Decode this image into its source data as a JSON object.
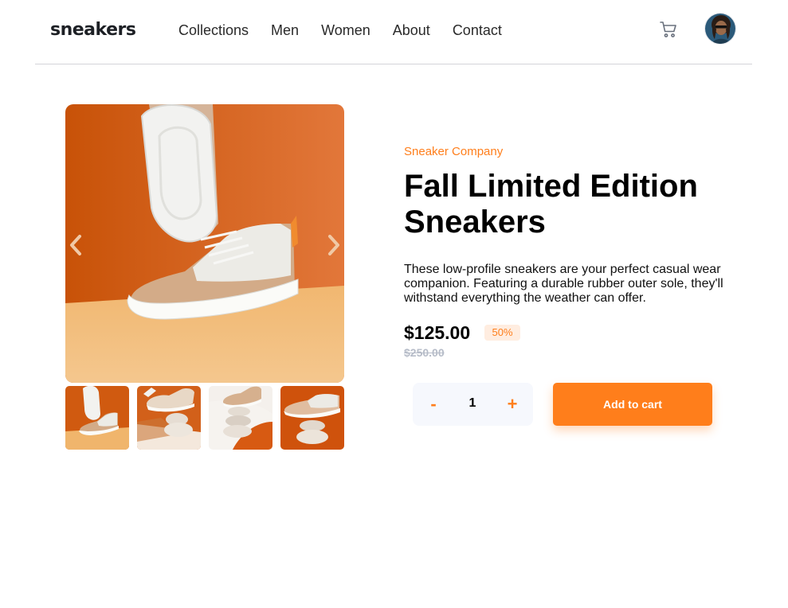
{
  "header": {
    "logo": "sneakers",
    "nav": [
      "Collections",
      "Men",
      "Women",
      "About",
      "Contact"
    ]
  },
  "gallery": {
    "main_image_alt": "sneaker",
    "thumbnail_count": 4
  },
  "product": {
    "company": "Sneaker Company",
    "title_line1": "Fall Limited Edition",
    "title_line2": "Sneakers",
    "description": "These low-profile sneakers are your perfect casual wear companion. Featuring a durable rubber outer sole, they'll withstand everything the weather can offer.",
    "price": "$125.00",
    "discount": "50%",
    "old_price": "$250.00"
  },
  "cart": {
    "minus_label": "-",
    "quantity": "1",
    "plus_label": "+",
    "add_label": "Add to cart"
  },
  "colors": {
    "accent": "#ff7e1b",
    "accent_light": "#ffede0",
    "qty_bg": "#f6f8fd"
  }
}
